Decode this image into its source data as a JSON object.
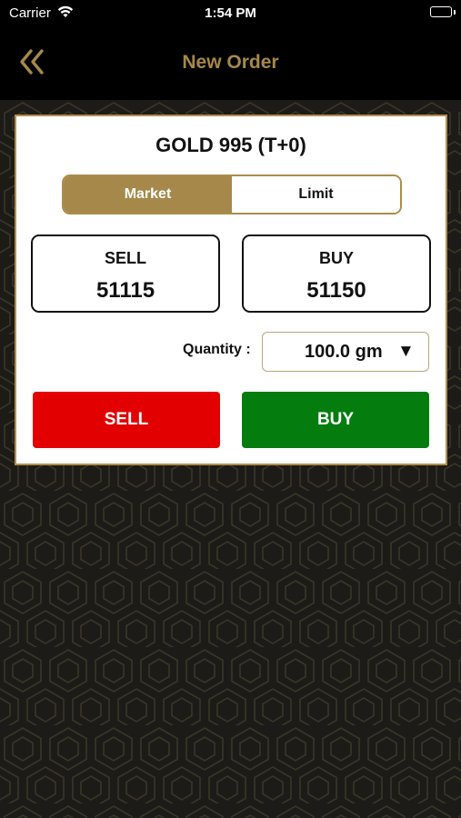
{
  "status_bar": {
    "carrier": "Carrier",
    "time": "1:54 PM"
  },
  "header": {
    "title": "New Order",
    "back_icon": "double-chevron-left-icon"
  },
  "order": {
    "instrument": "GOLD 995 (T+0)",
    "order_types": [
      "Market",
      "Limit"
    ],
    "selected_order_type": "Market",
    "sell": {
      "label": "SELL",
      "price": "51115"
    },
    "buy": {
      "label": "BUY",
      "price": "51150"
    },
    "quantity": {
      "label": "Quantity :",
      "value": "100.0 gm",
      "caret": "▼"
    },
    "buttons": {
      "sell_label": "SELL",
      "buy_label": "BUY"
    }
  },
  "colors": {
    "accent_gold": "#a6884a",
    "sell_red": "#e20000",
    "buy_green": "#047c0e",
    "background_dark": "#1c1b18"
  }
}
